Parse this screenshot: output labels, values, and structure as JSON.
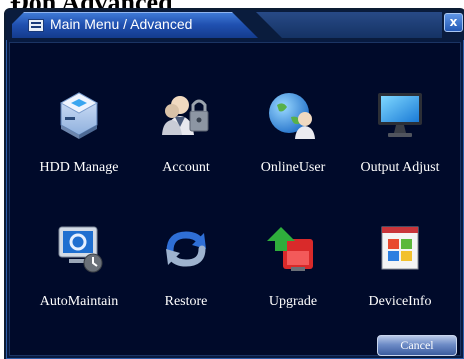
{
  "background": {
    "heading": "Ɖon Advanced"
  },
  "window": {
    "title": "Main Menu / Advanced",
    "close_label": "x",
    "accent_color": "#2050b0",
    "background_color": "#000a2a"
  },
  "menu": {
    "items": [
      {
        "label": "HDD Manage",
        "icon": "hard-drive-icon"
      },
      {
        "label": "Account",
        "icon": "users-lock-icon"
      },
      {
        "label": "OnlineUser",
        "icon": "globe-users-icon"
      },
      {
        "label": "Output Adjust",
        "icon": "monitor-icon"
      },
      {
        "label": "AutoMaintain",
        "icon": "maintain-monitor-icon"
      },
      {
        "label": "Restore",
        "icon": "restore-arrows-icon"
      },
      {
        "label": "Upgrade",
        "icon": "upgrade-arrow-icon"
      },
      {
        "label": "DeviceInfo",
        "icon": "device-info-window-icon"
      }
    ]
  },
  "footer": {
    "cancel_label": "Cancel"
  }
}
